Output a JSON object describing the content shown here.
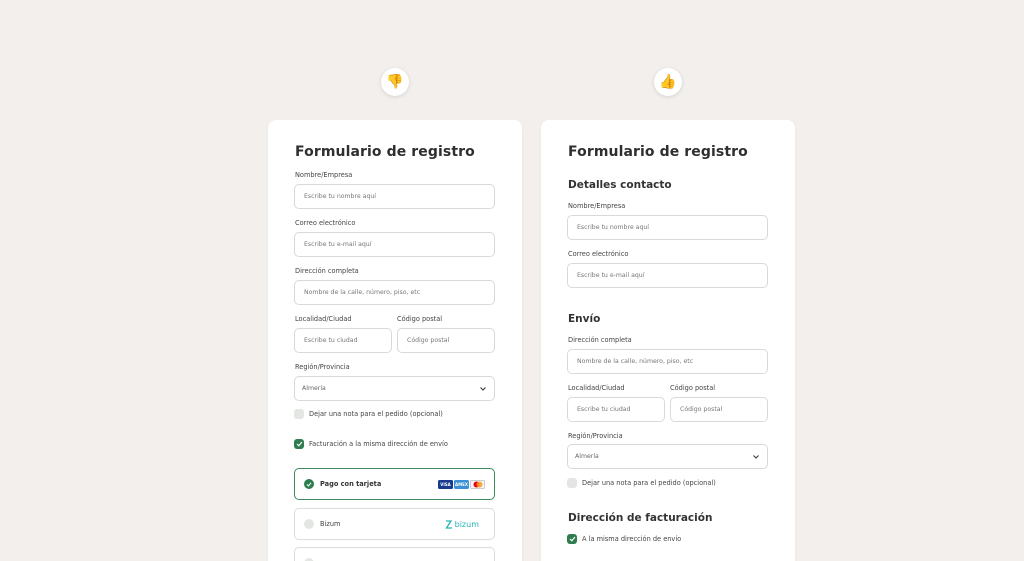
{
  "badges": {
    "left_icon": "thumbs-down-icon",
    "right_icon": "thumbs-up-icon",
    "left_glyph": "👎",
    "right_glyph": "👍"
  },
  "colors": {
    "background": "#f2efec",
    "card": "#ffffff",
    "accent_green": "#2e7d4f",
    "bizum": "#27b3b3"
  },
  "left_form": {
    "title": "Formulario de registro",
    "name_label": "Nombre/Empresa",
    "name_placeholder": "Escribe tu nombre aquí",
    "email_label": "Correo electrónico",
    "email_placeholder": "Escribe tu e-mail aquí",
    "address_label": "Dirección completa",
    "address_placeholder": "Nombre de la calle, número, piso, etc",
    "city_label": "Localidad/Ciudad",
    "city_placeholder": "Escribe tu ciudad",
    "zip_label": "Código postal",
    "zip_placeholder": "Código postal",
    "region_label": "Región/Provincia",
    "region_value": "Almería",
    "note_checkbox": "Dejar una nota para el pedido (opcional)",
    "billing_checkbox": "Facturación a la misma dirección de envío",
    "payment_card": "Pago con tarjeta",
    "payment_bizum": "Bizum",
    "bizum_logo_text": "bizum",
    "card_brands": [
      "VISA",
      "AMEX",
      "MC"
    ]
  },
  "right_form": {
    "title": "Formulario de registro",
    "contact_section": "Detalles contacto",
    "name_label": "Nombre/Empresa",
    "name_placeholder": "Escribe tu nombre aquí",
    "email_label": "Correo electrónico",
    "email_placeholder": "Escribe tu e-mail aquí",
    "shipping_section": "Envío",
    "address_label": "Dirección completa",
    "address_placeholder": "Nombre de la calle, número, piso, etc",
    "city_label": "Localidad/Ciudad",
    "city_placeholder": "Escribe tu ciudad",
    "zip_label": "Código postal",
    "zip_placeholder": "Código postal",
    "region_label": "Región/Provincia",
    "region_value": "Almería",
    "note_checkbox": "Dejar una nota para el pedido (opcional)",
    "billing_section": "Dirección de facturación",
    "billing_checkbox": "A la misma dirección de envío"
  }
}
